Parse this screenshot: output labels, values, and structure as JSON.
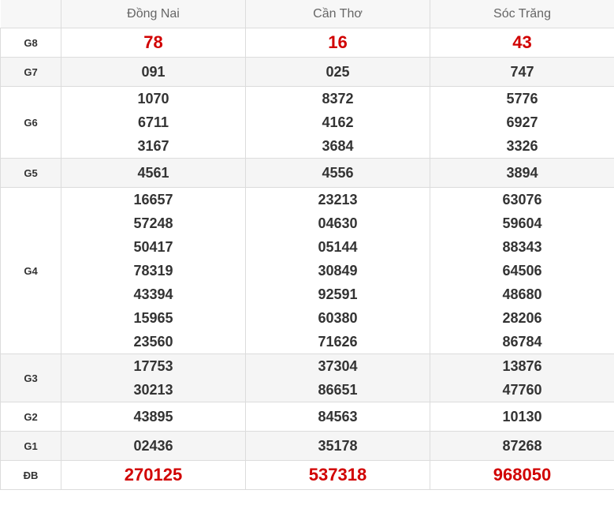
{
  "header": {
    "provinces": [
      "Đồng Nai",
      "Cần Thơ",
      "Sóc Trăng"
    ]
  },
  "rows": [
    {
      "label": "G8",
      "highlight": true,
      "shaded": false,
      "values": [
        [
          "78"
        ],
        [
          "16"
        ],
        [
          "43"
        ]
      ]
    },
    {
      "label": "G7",
      "highlight": false,
      "shaded": true,
      "values": [
        [
          "091"
        ],
        [
          "025"
        ],
        [
          "747"
        ]
      ]
    },
    {
      "label": "G6",
      "highlight": false,
      "shaded": false,
      "values": [
        [
          "1070",
          "6711",
          "3167"
        ],
        [
          "8372",
          "4162",
          "3684"
        ],
        [
          "5776",
          "6927",
          "3326"
        ]
      ]
    },
    {
      "label": "G5",
      "highlight": false,
      "shaded": true,
      "values": [
        [
          "4561"
        ],
        [
          "4556"
        ],
        [
          "3894"
        ]
      ]
    },
    {
      "label": "G4",
      "highlight": false,
      "shaded": false,
      "values": [
        [
          "16657",
          "57248",
          "50417",
          "78319",
          "43394",
          "15965",
          "23560"
        ],
        [
          "23213",
          "04630",
          "05144",
          "30849",
          "92591",
          "60380",
          "71626"
        ],
        [
          "63076",
          "59604",
          "88343",
          "64506",
          "48680",
          "28206",
          "86784"
        ]
      ]
    },
    {
      "label": "G3",
      "highlight": false,
      "shaded": true,
      "values": [
        [
          "17753",
          "30213"
        ],
        [
          "37304",
          "86651"
        ],
        [
          "13876",
          "47760"
        ]
      ]
    },
    {
      "label": "G2",
      "highlight": false,
      "shaded": false,
      "values": [
        [
          "43895"
        ],
        [
          "84563"
        ],
        [
          "10130"
        ]
      ]
    },
    {
      "label": "G1",
      "highlight": false,
      "shaded": true,
      "values": [
        [
          "02436"
        ],
        [
          "35178"
        ],
        [
          "87268"
        ]
      ]
    },
    {
      "label": "ĐB",
      "highlight": true,
      "shaded": false,
      "values": [
        [
          "270125"
        ],
        [
          "537318"
        ],
        [
          "968050"
        ]
      ]
    }
  ],
  "colors": {
    "highlight": "#d10000",
    "shade": "#f5f5f5",
    "header_bg": "#f7f7f7"
  }
}
